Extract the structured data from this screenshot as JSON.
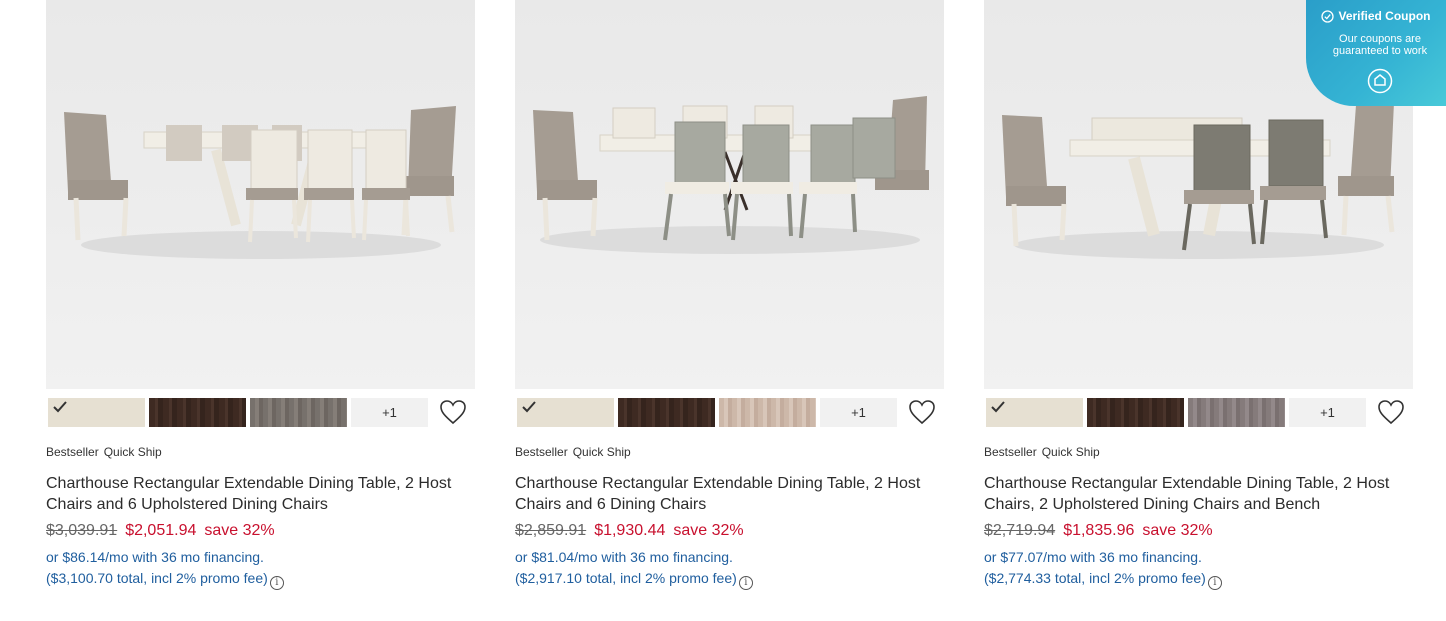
{
  "products": [
    {
      "badges": [
        "Bestseller",
        "Quick Ship"
      ],
      "title": "Charthouse Rectangular Extendable Dining Table, 2 Host Chairs and 6 Upholstered Dining Chairs",
      "old_price": "$3,039.91",
      "new_price": "$2,051.94",
      "save": "save 32%",
      "financing_line1": "or $86.14/mo with 36 mo financing.",
      "financing_line2": "($3,100.70 total, incl 2% promo fee)",
      "swatches": [
        {
          "name": "white finish",
          "color": "#e6e0d2"
        },
        {
          "name": "dark brown finish",
          "color": "#3e2a22"
        },
        {
          "name": "grey finish",
          "color": "#77716c"
        }
      ],
      "more_swatches": "+1"
    },
    {
      "badges": [
        "Bestseller",
        "Quick Ship"
      ],
      "title": "Charthouse Rectangular Extendable Dining Table, 2 Host Chairs and 6 Dining Chairs",
      "old_price": "$2,859.91",
      "new_price": "$1,930.44",
      "save": "save 32%",
      "financing_line1": "or $81.04/mo with 36 mo financing.",
      "financing_line2": "($2,917.10 total, incl 2% promo fee)",
      "swatches": [
        {
          "name": "white finish",
          "color": "#e6e0d2"
        },
        {
          "name": "dark brown finish",
          "color": "#3e2a22"
        },
        {
          "name": "light oak finish",
          "color": "#cdb8a9"
        }
      ],
      "more_swatches": "+1"
    },
    {
      "badges": [
        "Bestseller",
        "Quick Ship"
      ],
      "title": "Charthouse Rectangular Extendable Dining Table, 2 Host Chairs, 2 Upholstered Dining Chairs and Bench",
      "old_price": "$2,719.94",
      "new_price": "$1,835.96",
      "save": "save 32%",
      "financing_line1": "or $77.07/mo with 36 mo financing.",
      "financing_line2": "($2,774.33 total, incl 2% promo fee)",
      "swatches": [
        {
          "name": "white finish",
          "color": "#e6e0d2"
        },
        {
          "name": "dark brown finish",
          "color": "#3e2a22"
        },
        {
          "name": "grey finish",
          "color": "#857b7b"
        }
      ],
      "more_swatches": "+1"
    }
  ],
  "coupon": {
    "title": "Verified Coupon",
    "subtitle": "Our coupons are guaranteed to work"
  },
  "colors": {
    "sale_red": "#c8102e",
    "financing_blue": "#1f5e9e",
    "coupon_teal": "#35b4d4"
  }
}
